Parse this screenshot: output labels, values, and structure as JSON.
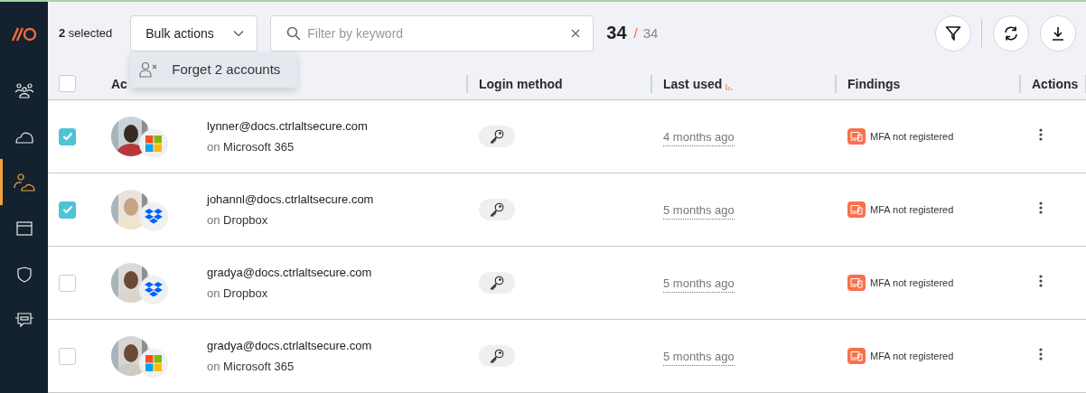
{
  "sidebar": {
    "items": [
      {
        "selected": false
      },
      {
        "selected": false
      },
      {
        "selected": true
      },
      {
        "selected": false
      },
      {
        "selected": false
      },
      {
        "selected": false
      }
    ]
  },
  "toolbar": {
    "selection": "**2** selected",
    "bulk_actions": {
      "label": "Bulk actions",
      "expanded": true,
      "menu": [
        {
          "label": "Forget 2 accounts"
        }
      ]
    },
    "search": {
      "placeholder": "Filter by keyword"
    },
    "count": {
      "shown": "34",
      "separator": "/",
      "total": "34"
    }
  },
  "table": {
    "select_all": {
      "checked": false
    },
    "columns": [
      {
        "label": "Ac",
        "sorted": false
      },
      {
        "label": "Login method",
        "sorted": false
      },
      {
        "label": "Last used",
        "sorted": true
      },
      {
        "label": "Findings",
        "sorted": false
      },
      {
        "label": "Actions",
        "sorted": false
      }
    ],
    "rows": [
      {
        "selected": true,
        "email": "lynner@docs.ctrlaltsecure.com",
        "prefix": "on",
        "platform": "Microsoft 365",
        "kind": "microsoft",
        "last_used": "4 months ago",
        "finding": "MFA not registered"
      },
      {
        "selected": true,
        "email": "johannl@docs.ctrlaltsecure.com",
        "prefix": "on",
        "platform": "Dropbox",
        "kind": "dropbox",
        "last_used": "5 months ago",
        "finding": "MFA not registered"
      },
      {
        "selected": false,
        "email": "gradya@docs.ctrlaltsecure.com",
        "prefix": "on",
        "platform": "Dropbox",
        "kind": "dropbox",
        "last_used": "5 months ago",
        "finding": "MFA not registered"
      },
      {
        "selected": false,
        "email": "gradya@docs.ctrlaltsecure.com",
        "prefix": "on",
        "platform": "Microsoft 365",
        "kind": "microsoft",
        "last_used": "5 months ago",
        "finding": "MFA not registered"
      }
    ]
  }
}
